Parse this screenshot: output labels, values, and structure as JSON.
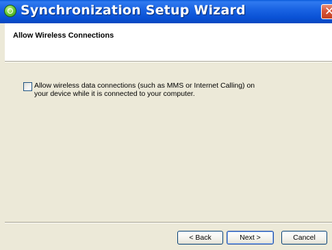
{
  "window": {
    "title": "Synchronization Setup Wizard",
    "close_symbol": "✕"
  },
  "header": {
    "title": "Allow Wireless Connections"
  },
  "options": {
    "wireless_checkbox": {
      "checked": false,
      "label_line1": "Allow wireless data connections (such as MMS or Internet Calling) on",
      "label_line2": "your device while it is connected to your computer."
    }
  },
  "buttons": {
    "back": "< Back",
    "next": "Next >",
    "cancel": "Cancel"
  },
  "icons": {
    "app": "sync-app-icon",
    "close": "close-icon"
  },
  "colors": {
    "titlebar": "#0a52d6",
    "dialog_background": "#ece9d8",
    "close_button": "#d7553a"
  }
}
